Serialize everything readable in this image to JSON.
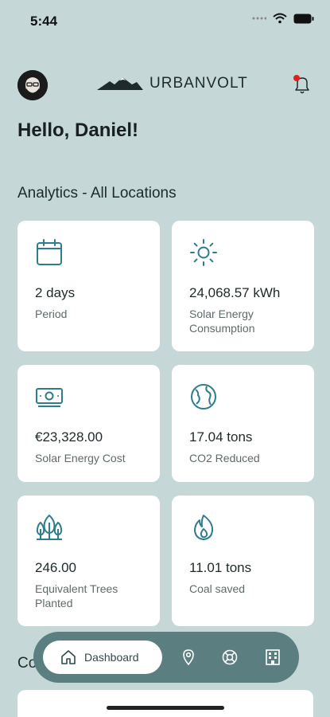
{
  "status": {
    "time": "5:44",
    "icons": [
      "dots-icon",
      "wifi-icon",
      "battery-icon"
    ]
  },
  "header": {
    "brand": "URBANVOLT",
    "avatar_icon": "avatar",
    "notification_icon": "bell-icon",
    "notification_dot_color": "#e0201b"
  },
  "greeting": "Hello, Daniel!",
  "analytics": {
    "title": "Analytics - All Locations",
    "cards": [
      {
        "icon": "calendar-icon",
        "value": "2 days",
        "label": "Period"
      },
      {
        "icon": "sun-icon",
        "value": "24,068.57 kWh",
        "label": "Solar Energy Consumption"
      },
      {
        "icon": "money-icon",
        "value": "€23,328.00",
        "label": "Solar Energy Cost"
      },
      {
        "icon": "globe-icon",
        "value": "17.04 tons",
        "label": "CO2 Reduced"
      },
      {
        "icon": "trees-icon",
        "value": "246.00",
        "label": "Equivalent Trees Planted"
      },
      {
        "icon": "flame-icon",
        "value": "11.01 tons",
        "label": "Coal saved"
      }
    ]
  },
  "next_section": {
    "title": "Co"
  },
  "tabbar": {
    "active": {
      "icon": "home-icon",
      "label": "Dashboard"
    },
    "tabs": [
      "location-pin-icon",
      "support-icon",
      "building-icon"
    ]
  },
  "colors": {
    "background": "#c5d7d7",
    "accent": "#2e7d8c",
    "tabbar": "#5b7f80"
  }
}
